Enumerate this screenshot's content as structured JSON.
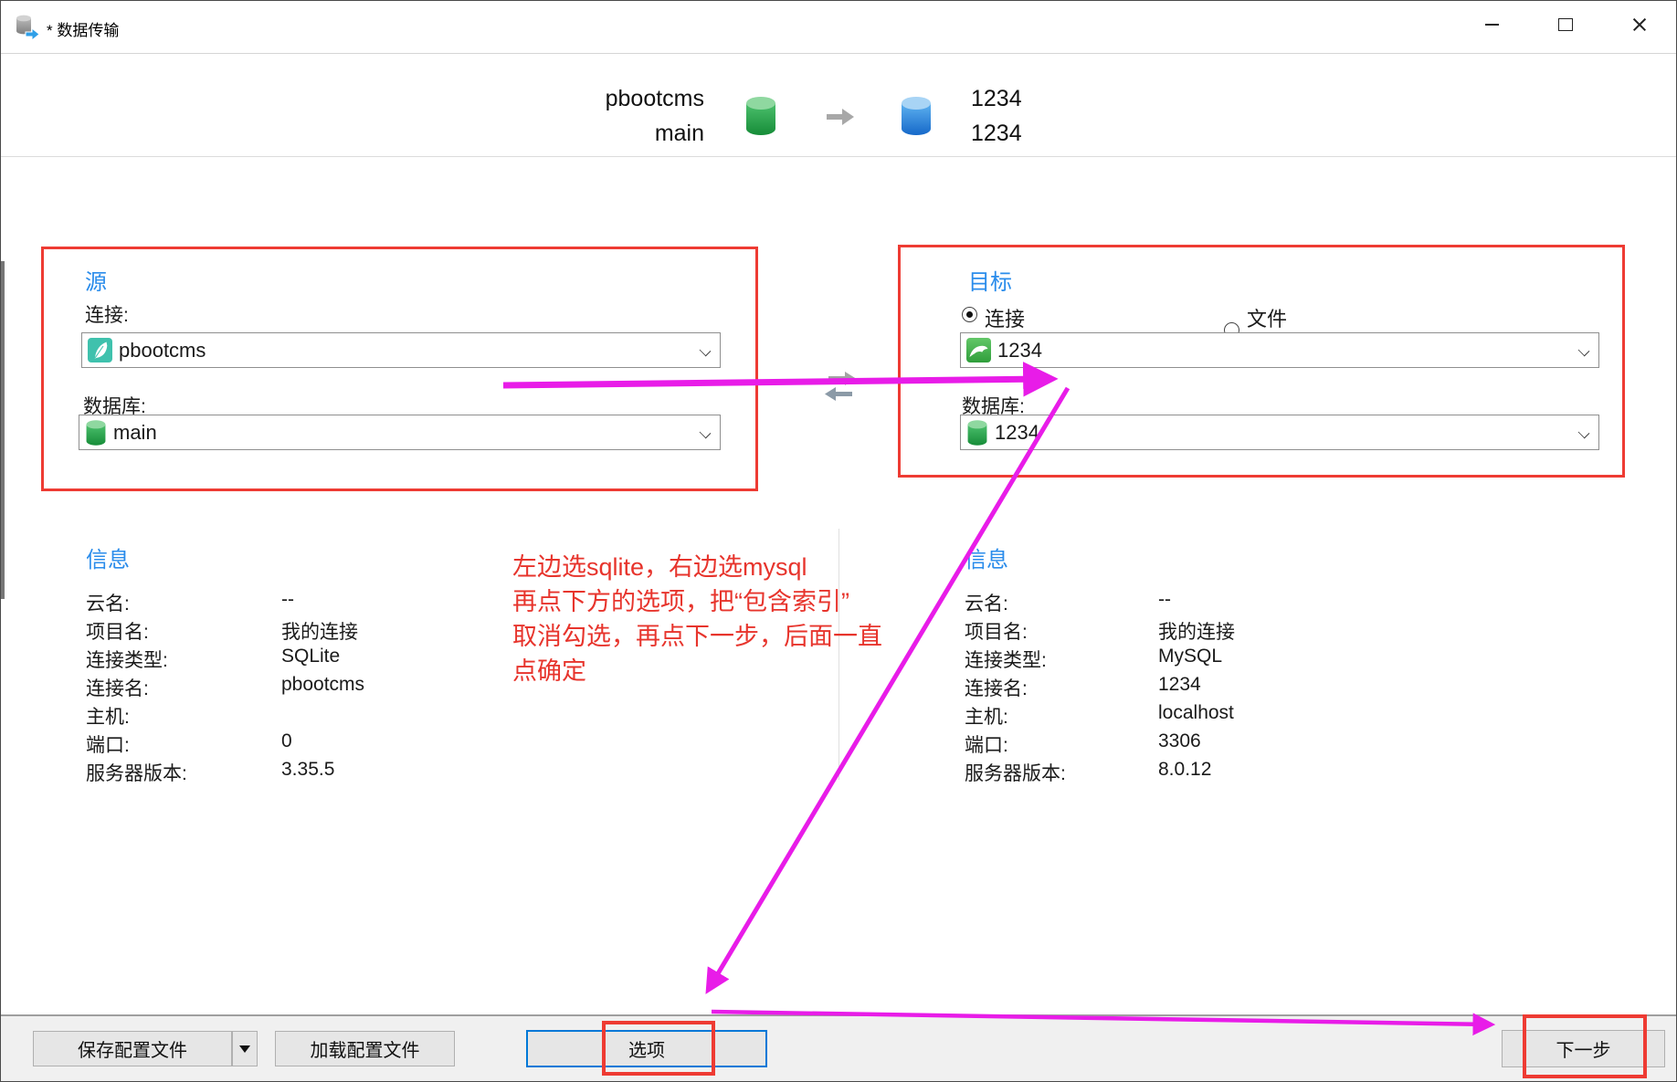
{
  "window": {
    "title": "* 数据传输"
  },
  "header": {
    "source_name": "pbootcms",
    "source_db": "main",
    "target_name": "1234",
    "target_db": "1234"
  },
  "source_panel": {
    "title": "源",
    "connection_label": "连接:",
    "connection_value": "pbootcms",
    "database_label": "数据库:",
    "database_value": "main"
  },
  "target_panel": {
    "title": "目标",
    "radio_connection_label": "连接",
    "radio_file_label": "文件",
    "connection_value": "1234",
    "database_label": "数据库:",
    "database_value": "1234"
  },
  "info_left": {
    "title": "信息",
    "rows": [
      {
        "label": "云名:",
        "value": "--"
      },
      {
        "label": "项目名:",
        "value": "我的连接"
      },
      {
        "label": "连接类型:",
        "value": "SQLite"
      },
      {
        "label": "连接名:",
        "value": "pbootcms"
      },
      {
        "label": "主机:",
        "value": ""
      },
      {
        "label": "端口:",
        "value": "0"
      },
      {
        "label": "服务器版本:",
        "value": "3.35.5"
      }
    ]
  },
  "info_right": {
    "title": "信息",
    "rows": [
      {
        "label": "云名:",
        "value": "--"
      },
      {
        "label": "项目名:",
        "value": "我的连接"
      },
      {
        "label": "连接类型:",
        "value": "MySQL"
      },
      {
        "label": "连接名:",
        "value": "1234"
      },
      {
        "label": "主机:",
        "value": "localhost"
      },
      {
        "label": "端口:",
        "value": "3306"
      },
      {
        "label": "服务器版本:",
        "value": "8.0.12"
      }
    ]
  },
  "annotation_lines": [
    "左边选sqlite，右边选mysql",
    "再点下方的选项，把“包含索引”",
    "取消勾选，再点下一步，后面一直",
    "点确定"
  ],
  "footer": {
    "save_label": "保存配置文件",
    "load_label": "加载配置文件",
    "options_label": "选项",
    "next_label": "下一步"
  },
  "colors": {
    "section_blue": "#2a8ceb",
    "highlight_red": "#ee3b33",
    "annotation_red": "#e7342c",
    "magenta": "#e81ce8",
    "focus_blue": "#0078d7"
  }
}
